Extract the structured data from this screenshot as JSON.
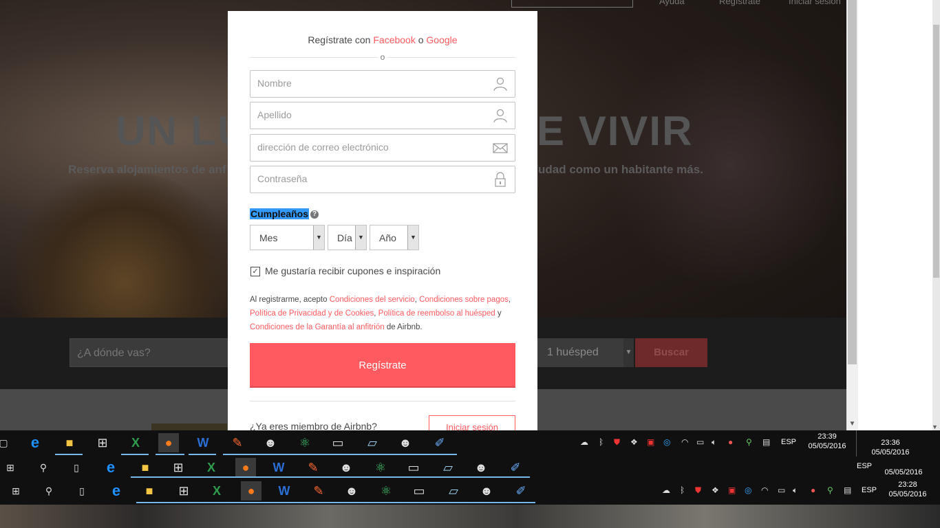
{
  "background": {
    "hero_title_left": "UN LU",
    "hero_title_right": "E VIVIR",
    "hero_subtitle_left": "Reserva alojamientos de anf",
    "hero_subtitle_right": "udad como un habitante más.",
    "nav_links": [
      "Ayuda",
      "Regístrate",
      "Iniciar sesión"
    ],
    "search_placeholder": "¿A dónde vas?",
    "guests_value": "1 huésped",
    "search_button": "Buscar"
  },
  "modal": {
    "social_prefix": "Regístrate con",
    "facebook_label": "Facebook",
    "or_label": "o",
    "google_label": "Google",
    "divider_text": "o",
    "fields": {
      "first_name_placeholder": "Nombre",
      "last_name_placeholder": "Apellido",
      "email_placeholder": "dirección de correo electrónico",
      "password_placeholder": "Contraseña"
    },
    "birthday_label": "Cumpleaños",
    "help_glyph": "?",
    "month_value": "Mes",
    "day_value": "Día",
    "year_value": "Año",
    "coupons_checked": true,
    "coupons_label": "Me gustaría recibir cupones e inspiración",
    "terms": {
      "t1": "Al registrarme, acepto ",
      "l1": "Condiciones del servicio",
      "t2": ", ",
      "l2": "Condiciones sobre pagos",
      "t3": ", ",
      "l3": "Política de Privacidad y de Cookies",
      "t4": ", ",
      "l4": "Política de reembolso al huésped",
      "t5": " y ",
      "l5": "Condiciones de la Garantía al anfitrión",
      "t6": " de Airbnb."
    },
    "register_button": "Regístrate",
    "member_prompt": "¿Ya eres miembro de Airbnb?",
    "login_button": "Iniciar sesión"
  },
  "taskbar": {
    "lang": "ESP",
    "clocks": [
      {
        "time": "23:39",
        "date": "05/05/2016"
      },
      {
        "time": "23:36",
        "date": "05/05/2016"
      },
      {
        "time": "",
        "date": "05/05/2016"
      },
      {
        "time": "23:28",
        "date": "05/05/2016"
      }
    ]
  },
  "colors": {
    "accent": "#ff5a5f",
    "selection": "#3399ff",
    "taskbar": "#101010"
  }
}
